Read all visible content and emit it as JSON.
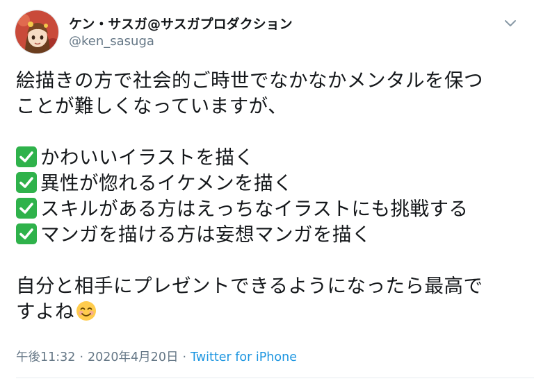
{
  "user": {
    "display_name": "ケン・サスガ@サスガプロダクション",
    "handle": "@ken_sasuga"
  },
  "tweet": {
    "intro_line_1": "絵描きの方で社会的ご時世でなかなかメンタルを保つ",
    "intro_line_2": "ことが難しくなっていますが、",
    "checklist": [
      "かわいいイラストを描く",
      "異性が惚れるイケメンを描く",
      "スキルがある方はえっちなイラストにも挑戦する",
      "マンガを描ける方は妄想マンガを描く"
    ],
    "outro_line_1": "自分と相手にプレゼントできるようになったら最高で",
    "outro_line_2": "すよね"
  },
  "meta": {
    "time": "午後11:32",
    "separator": "·",
    "date": "2020年4月20日",
    "source": "Twitter for iPhone"
  },
  "icons": {
    "check_emoji": "white-heavy-check-mark",
    "smile_emoji": "smiling-face-with-smiling-eyes",
    "menu_chevron": "chevron-down-icon"
  },
  "colors": {
    "text": "#14171a",
    "secondary": "#657786",
    "link": "#1b95e0",
    "check_green": "#2fb24b",
    "emoji_yellow": "#ffcc4d"
  }
}
